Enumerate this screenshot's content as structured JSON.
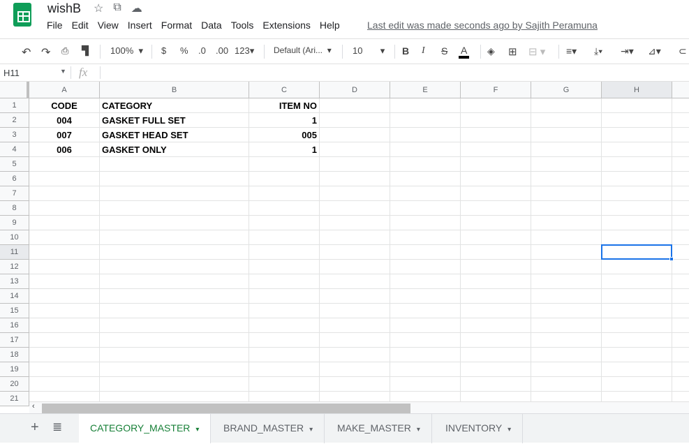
{
  "app": {
    "title": "wishB",
    "menu": [
      "File",
      "Edit",
      "View",
      "Insert",
      "Format",
      "Data",
      "Tools",
      "Extensions",
      "Help"
    ],
    "last_edit": "Last edit was made seconds ago by Sajith Peramuna"
  },
  "toolbar": {
    "zoom": "100%",
    "currency": "$",
    "percent": "%",
    "dec_decrease": ".0",
    "dec_increase": ".00",
    "format": "123",
    "font": "Default (Ari...",
    "font_size": "10",
    "bold": "B",
    "italic": "I",
    "strike": "S",
    "text_color": "A"
  },
  "formula_bar": {
    "cell_ref": "H11",
    "fx": "fx",
    "value": ""
  },
  "columns": [
    "A",
    "B",
    "C",
    "D",
    "E",
    "F",
    "G",
    "H"
  ],
  "rows": [
    [
      "CODE",
      "CATEGORY",
      "ITEM NO"
    ],
    [
      "004",
      "GASKET FULL SET",
      "1"
    ],
    [
      "007",
      "GASKET HEAD SET",
      "005"
    ],
    [
      "006",
      "GASKET ONLY",
      "1"
    ]
  ],
  "row_count": 21,
  "selected_cell": "H11",
  "sheets": [
    {
      "label": "CATEGORY_MASTER",
      "active": true
    },
    {
      "label": "BRAND_MASTER"
    },
    {
      "label": "MAKE_MASTER"
    },
    {
      "label": "INVENTORY"
    }
  ]
}
